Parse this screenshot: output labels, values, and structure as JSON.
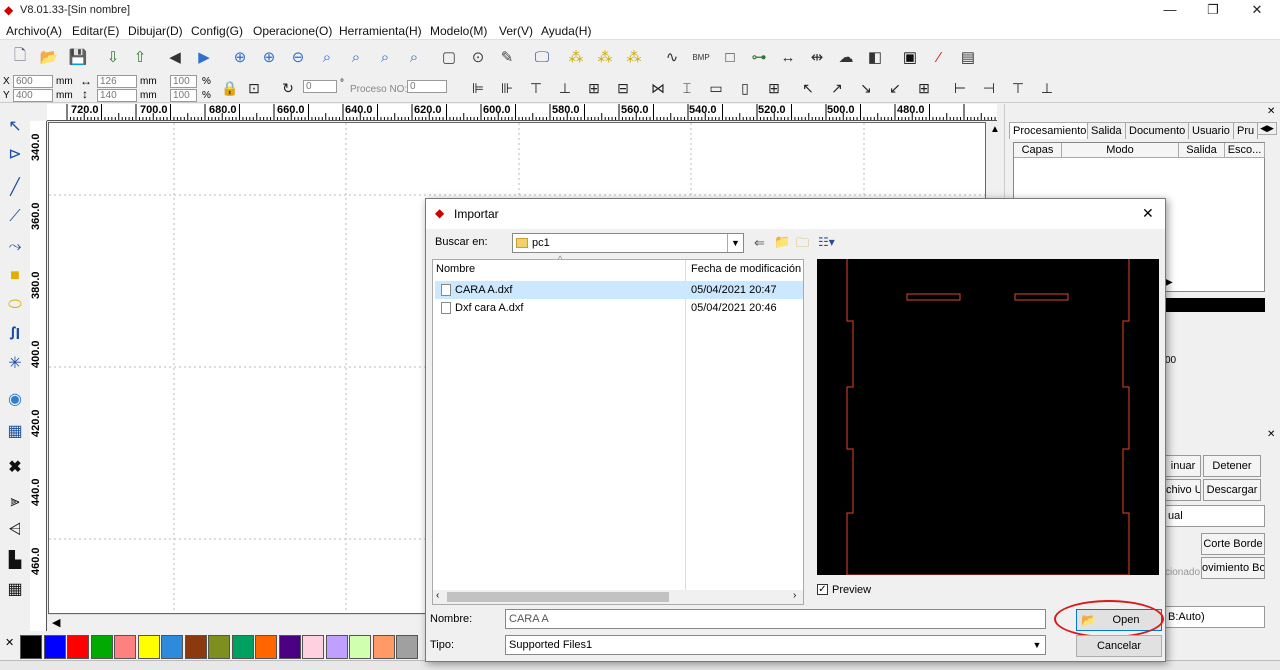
{
  "window": {
    "title": "V8.01.33-[Sin nombre]"
  },
  "menu": [
    "Archivo(A)",
    "Editar(E)",
    "Dibujar(D)",
    "Config(G)",
    "Operacione(O)",
    "Herramienta(H)",
    "Modelo(M)",
    "Ver(V)",
    "Ayuda(H)"
  ],
  "toolbar2": {
    "x_label": "X",
    "y_label": "Y",
    "x_val": "600",
    "y_val": "400",
    "mm": "mm",
    "w_val": "126",
    "h_val": "140",
    "sx_val": "100",
    "sy_val": "100",
    "pct": "%",
    "rot_val": "0",
    "deg": "°",
    "proceso_label": "Proceso NO:",
    "proceso_val": "0"
  },
  "ruler_h": [
    "720.0",
    "700.0",
    "680.0",
    "660.0",
    "640.0",
    "620.0",
    "600.0",
    "580.0",
    "560.0",
    "540.0",
    "520.0",
    "500.0",
    "480.0"
  ],
  "ruler_v": [
    "340.0",
    "360.0",
    "380.0",
    "400.0",
    "420.0",
    "440.0",
    "460.0"
  ],
  "palette": [
    "#000000",
    "#0000ff",
    "#ff0000",
    "#00aa00",
    "#ff8080",
    "#ffff00",
    "#2e8bdc",
    "#8b3a0f",
    "#7f8f1f",
    "#00a060",
    "#ff6600",
    "#4b0082",
    "#ffd0e0",
    "#c0a0ff",
    "#d0ffb0",
    "#ff9966",
    "#a0a0a0"
  ],
  "right_panel": {
    "tabs": [
      "Procesamiento",
      "Salida",
      "Documento",
      "Usuario",
      "Pru"
    ],
    "columns": [
      "Capas",
      "Modo",
      "Salida",
      "Esco..."
    ],
    "partial_text": "00",
    "buttons": {
      "continuar": "inuar",
      "detener": "Detener",
      "archivo": "chivo U",
      "descargar": "Descargar",
      "mode": "ual",
      "corte": "Corte Borde",
      "sel": "cionado",
      "mov": "ovimiento Bord",
      "port": "B:Auto)"
    }
  },
  "dialog": {
    "title": "Importar",
    "look_in_label": "Buscar en:",
    "look_in_value": "pc1",
    "col_name": "Nombre",
    "col_date": "Fecha de modificación",
    "files": [
      {
        "name": "CARA A.dxf",
        "date": "05/04/2021 20:47"
      },
      {
        "name": "Dxf cara A.dxf",
        "date": "05/04/2021 20:46"
      }
    ],
    "preview_label": "Preview",
    "name_label": "Nombre:",
    "name_value": "CARA A",
    "type_label": "Tipo:",
    "type_value": "Supported Files1",
    "open_btn": "Open",
    "cancel_btn": "Cancelar"
  }
}
